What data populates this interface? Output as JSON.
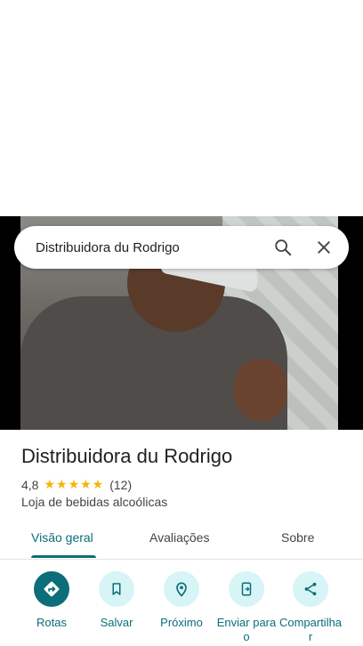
{
  "search": {
    "value": "Distribuidora du Rodrigo"
  },
  "place": {
    "name": "Distribuidora du Rodrigo",
    "rating": "4,8",
    "stars": "★★★★★",
    "reviews": "(12)",
    "category": "Loja de bebidas alcoólicas"
  },
  "tabs": [
    {
      "label": "Visão geral"
    },
    {
      "label": "Avaliações"
    },
    {
      "label": "Sobre"
    }
  ],
  "actions": [
    {
      "label": "Rotas",
      "icon": "directions-icon"
    },
    {
      "label": "Salvar",
      "icon": "bookmark-icon"
    },
    {
      "label": "Próximo",
      "icon": "nearby-icon"
    },
    {
      "label": "Enviar para o",
      "icon": "send-to-phone-icon"
    },
    {
      "label": "Compartilha r",
      "icon": "share-icon"
    }
  ],
  "colors": {
    "accent": "#0b6e7a",
    "action_bg": "#d7f4f6",
    "star": "#f5b400"
  }
}
